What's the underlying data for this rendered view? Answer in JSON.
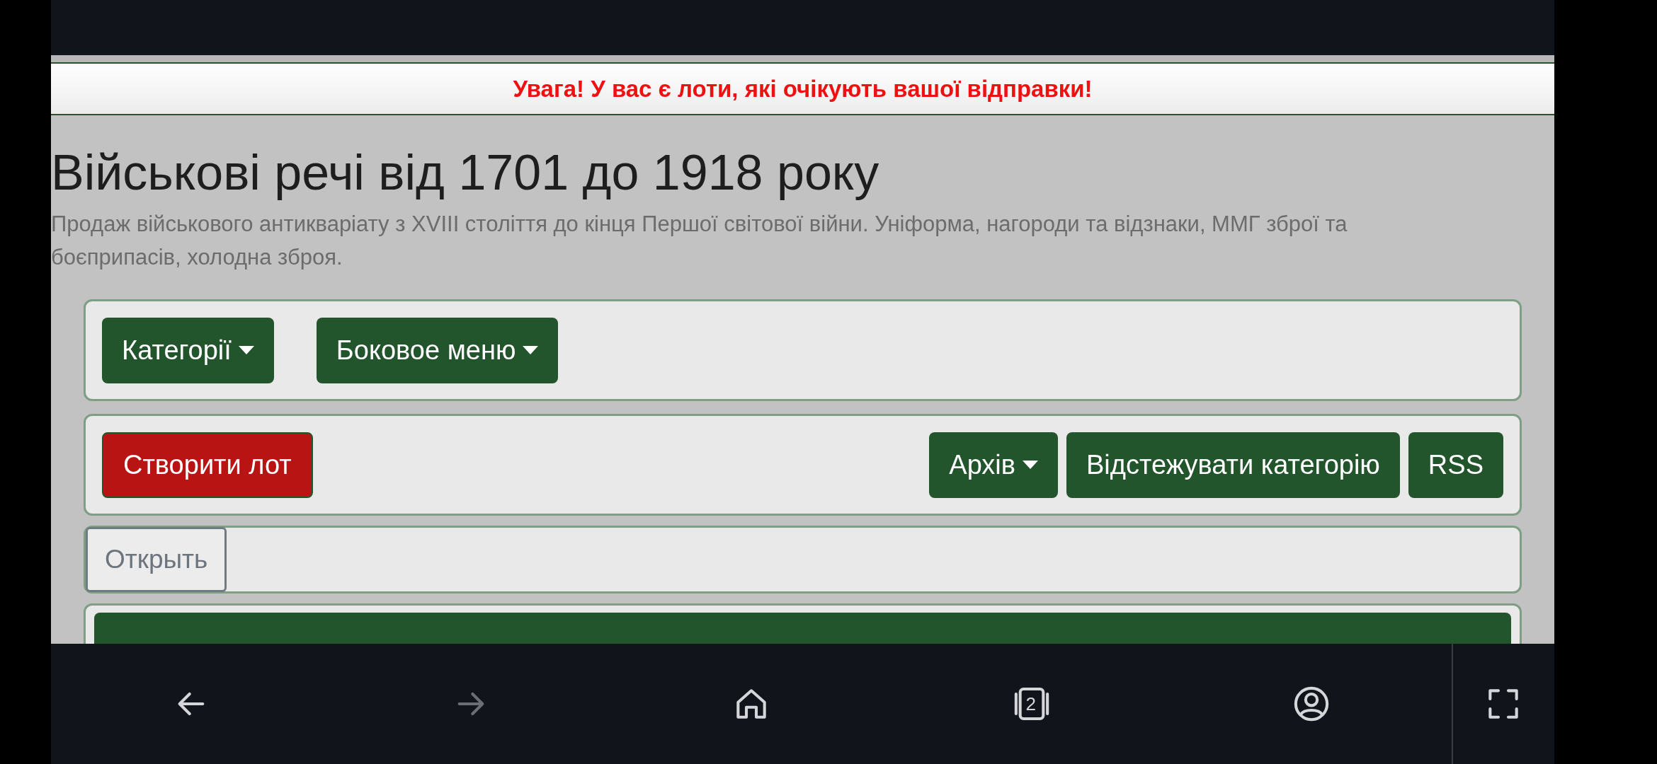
{
  "alert": {
    "text": "Увага! У вас є лоти, які очікують вашої відправки!"
  },
  "page": {
    "title": "Військові речі від 1701 до 1918 року",
    "subtitle": "Продаж військового антикваріату з XVIII століття до кінця Першої світової війни. Уніформа, нагороди та відзнаки, ММГ зброї та боєприпасів, холодна зброя."
  },
  "menu_bar": {
    "buttons": [
      {
        "label": "Категорії",
        "dropdown": true
      },
      {
        "label": "Боковое меню",
        "dropdown": true
      }
    ]
  },
  "action_bar": {
    "left_buttons": [
      {
        "label": "Створити лот",
        "kind": "danger",
        "dropdown": false
      }
    ],
    "right_buttons": [
      {
        "label": "Архів",
        "kind": "primary",
        "dropdown": true
      },
      {
        "label": "Відстежувати категорію",
        "kind": "primary",
        "dropdown": false
      },
      {
        "label": "RSS",
        "kind": "primary",
        "dropdown": false
      }
    ]
  },
  "open_bar": {
    "button": "Открыть"
  },
  "browser_nav": {
    "items": [
      {
        "kind": "back",
        "disabled": false
      },
      {
        "kind": "forward",
        "disabled": true
      },
      {
        "kind": "home",
        "disabled": false
      },
      {
        "kind": "tabs",
        "count": "2",
        "disabled": false
      },
      {
        "kind": "account",
        "disabled": false
      },
      {
        "kind": "fullscreen",
        "disabled": false
      }
    ]
  }
}
